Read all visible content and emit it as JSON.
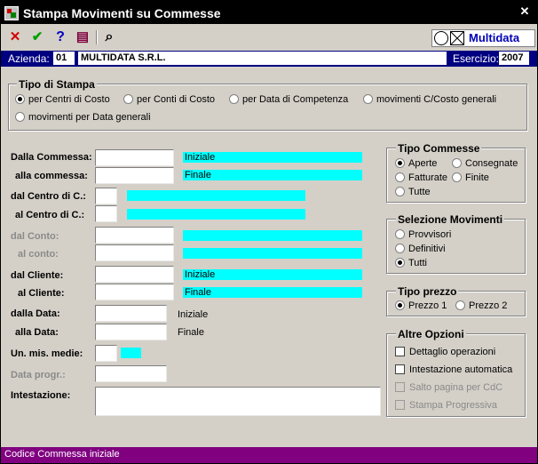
{
  "window": {
    "title": "Stampa Movimenti su Commesse",
    "close_glyph": "✕"
  },
  "toolbar": {
    "icons": [
      "cancel-icon",
      "confirm-icon",
      "help-icon",
      "book-icon",
      "binoculars-icon"
    ],
    "cancel_glyph": "✕",
    "confirm_glyph": "✔",
    "help_glyph": "?",
    "book_glyph": "▤",
    "find_glyph": "⌕",
    "logo_text": "Multidata"
  },
  "header": {
    "azienda_label": "Azienda:",
    "azienda_code": "01",
    "azienda_name": "MULTIDATA S.R.L.",
    "esercizio_label": "Esercizio:",
    "esercizio_value": "2007"
  },
  "tipo_stampa": {
    "title": "Tipo di Stampa",
    "options": [
      {
        "label": "per Centri di Costo",
        "selected": true
      },
      {
        "label": "per Conti di Costo",
        "selected": false
      },
      {
        "label": "per Data di Competenza",
        "selected": false
      },
      {
        "label": "movimenti C/Costo generali",
        "selected": false
      },
      {
        "label": "movimenti per Data generali",
        "selected": false
      }
    ]
  },
  "fields": {
    "dalla_commessa": {
      "label": "Dalla Commessa:",
      "value": "",
      "desc": "Iniziale"
    },
    "alla_commessa": {
      "label": "alla commessa:",
      "value": "",
      "desc": "Finale"
    },
    "dal_centro": {
      "label": "dal Centro di C.:",
      "value": "",
      "desc": ""
    },
    "al_centro": {
      "label": "al Centro di C.:",
      "value": "",
      "desc": ""
    },
    "dal_conto": {
      "label": "dal Conto:",
      "value": "",
      "desc": ""
    },
    "al_conto": {
      "label": "al conto:",
      "value": "",
      "desc": ""
    },
    "dal_cliente": {
      "label": "dal Cliente:",
      "value": "",
      "desc": "Iniziale"
    },
    "al_cliente": {
      "label": "al Cliente:",
      "value": "",
      "desc": "Finale"
    },
    "dalla_data": {
      "label": "dalla Data:",
      "value": "",
      "desc": "Iniziale"
    },
    "alla_data": {
      "label": "alla Data:",
      "value": "",
      "desc": "Finale"
    },
    "um_medie": {
      "label": "Un. mis. medie:",
      "value": "",
      "desc": ""
    },
    "data_progr": {
      "label": "Data progr.:",
      "value": ""
    },
    "intestazione": {
      "label": "Intestazione:",
      "value": ""
    }
  },
  "tipo_commesse": {
    "title": "Tipo Commesse",
    "options": [
      {
        "label": "Aperte",
        "selected": true
      },
      {
        "label": "Consegnate",
        "selected": false
      },
      {
        "label": "Fatturate",
        "selected": false
      },
      {
        "label": "Finite",
        "selected": false
      },
      {
        "label": "Tutte",
        "selected": false
      }
    ]
  },
  "selezione_movimenti": {
    "title": "Selezione Movimenti",
    "options": [
      {
        "label": "Provvisori",
        "selected": false
      },
      {
        "label": "Definitivi",
        "selected": false
      },
      {
        "label": "Tutti",
        "selected": true
      }
    ]
  },
  "tipo_prezzo": {
    "title": "Tipo prezzo",
    "options": [
      {
        "label": "Prezzo 1",
        "selected": true
      },
      {
        "label": "Prezzo 2",
        "selected": false
      }
    ]
  },
  "altre_opzioni": {
    "title": "Altre Opzioni",
    "options": [
      {
        "label": "Dettaglio operazioni",
        "checked": false,
        "enabled": true
      },
      {
        "label": "Intestazione automatica",
        "checked": false,
        "enabled": true
      },
      {
        "label": "Salto pagina per CdC",
        "checked": false,
        "enabled": false
      },
      {
        "label": "Stampa Progressiva",
        "checked": false,
        "enabled": false
      }
    ]
  },
  "colors": {
    "accent": "#00ffff",
    "header_bar": "#000080",
    "status_bar": "#800080"
  },
  "status": {
    "text": "Codice Commessa iniziale"
  }
}
